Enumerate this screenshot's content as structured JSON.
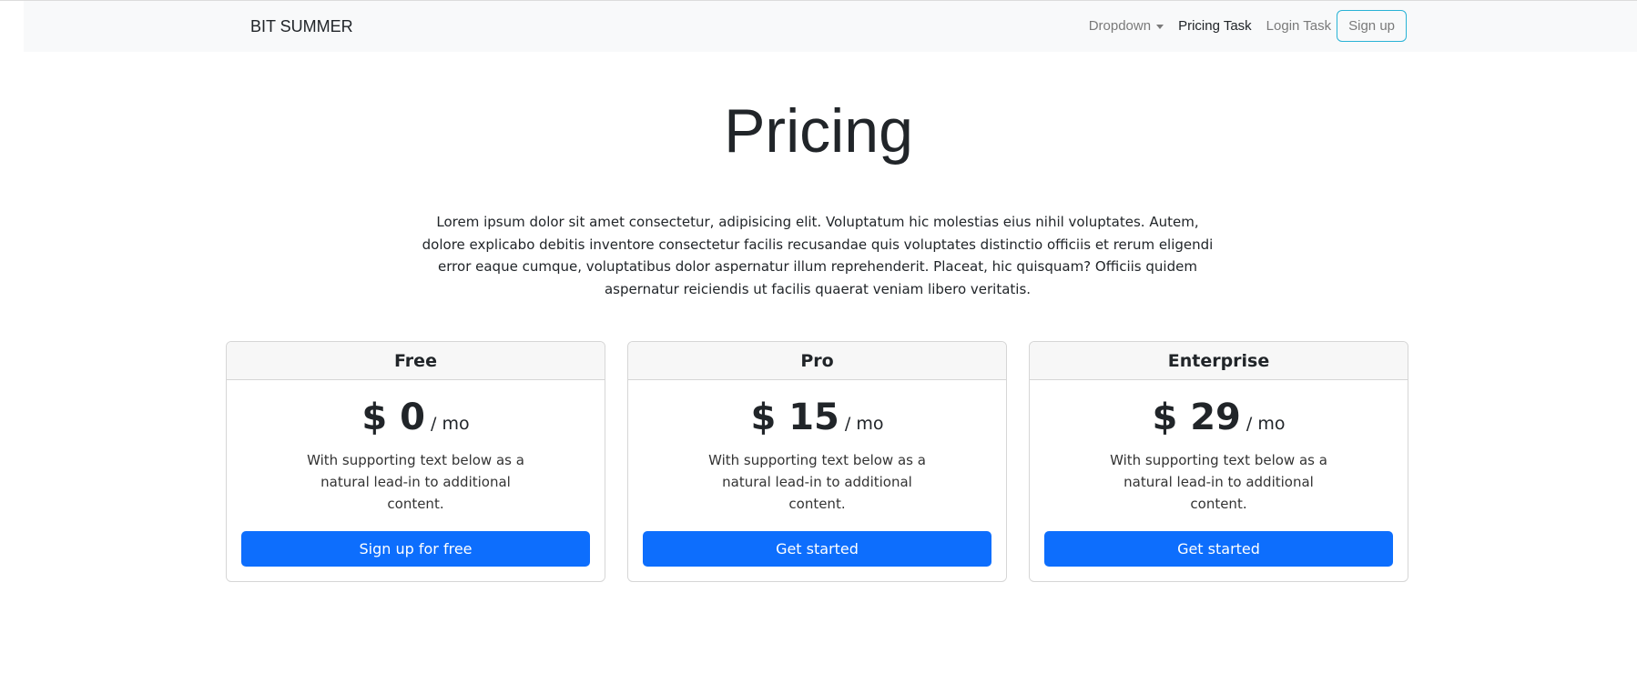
{
  "navbar": {
    "brand": "BIT SUMMER",
    "links": [
      "Dropdown",
      "Pricing Task",
      "Login Task"
    ],
    "signup": "Sign up"
  },
  "header": {
    "title": "Pricing",
    "lead": "Lorem ipsum dolor sit amet consectetur, adipisicing elit. Voluptatum hic molestias eius nihil voluptates. Autem, dolore explicabo debitis inventore consectetur facilis recusandae quis voluptates distinctio officiis et rerum eligendi error eaque cumque, voluptatibus dolor aspernatur illum reprehenderit. Placeat, hic quisquam? Officiis quidem aspernatur reiciendis ut facilis quaerat veniam libero veritatis."
  },
  "plans": [
    {
      "name": "Free",
      "price": "$ 0",
      "period": " / mo",
      "text": "With supporting text below as a natural lead-in to additional content.",
      "button": "Sign up for free"
    },
    {
      "name": "Pro",
      "price": "$ 15",
      "period": " / mo",
      "text": "With supporting text below as a natural lead-in to additional content.",
      "button": "Get started"
    },
    {
      "name": "Enterprise",
      "price": "$ 29",
      "period": " / mo",
      "text": "With supporting text below as a natural lead-in to additional content.",
      "button": "Get started"
    }
  ]
}
